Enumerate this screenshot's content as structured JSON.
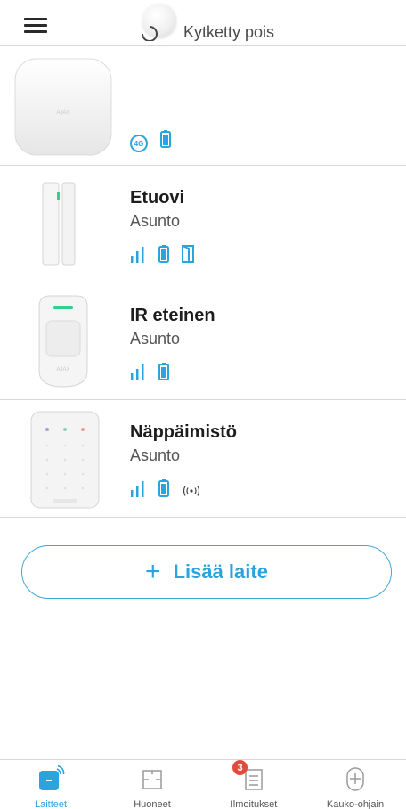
{
  "header": {
    "status_text": "Kytketty pois"
  },
  "hub": {
    "logo_text": "AJAX",
    "network_badge": "4G"
  },
  "devices": [
    {
      "name": "Etuovi",
      "room": "Asunto",
      "logo_text": ""
    },
    {
      "name": "IR eteinen",
      "room": "Asunto",
      "logo_text": "AJAX"
    },
    {
      "name": "Näppäimistö",
      "room": "Asunto",
      "logo_text": ""
    }
  ],
  "add_device": {
    "label": "Lisää laite"
  },
  "nav": {
    "items": [
      {
        "label": "Laitteet"
      },
      {
        "label": "Huoneet"
      },
      {
        "label": "Ilmoitukset",
        "badge": "3"
      },
      {
        "label": "Kauko-ohjain"
      }
    ]
  },
  "colors": {
    "accent": "#2aa4dd",
    "badge": "#e24b3b"
  }
}
